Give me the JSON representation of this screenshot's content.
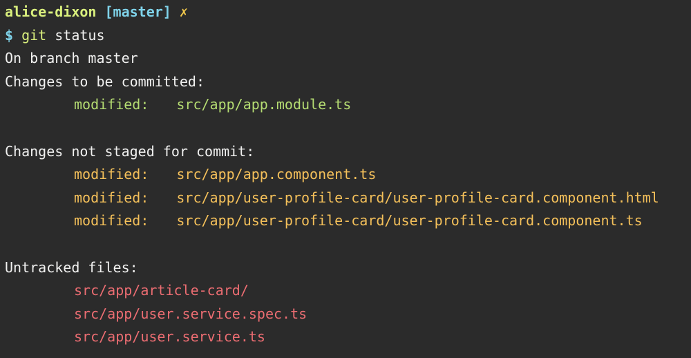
{
  "prompt": {
    "user": "alice-dixon",
    "branch": "[master]",
    "dirty_marker": "✗",
    "dollar": "$",
    "command_bin": "git",
    "command_arg": "status"
  },
  "output": {
    "on_branch": "On branch master",
    "staged_header": "Changes to be committed:",
    "staged": [
      {
        "status": "modified:",
        "path": "src/app/app.module.ts"
      }
    ],
    "unstaged_header": "Changes not staged for commit:",
    "unstaged": [
      {
        "status": "modified:",
        "path": "src/app/app.component.ts"
      },
      {
        "status": "modified:",
        "path": "src/app/user-profile-card/user-profile-card.component.html"
      },
      {
        "status": "modified:",
        "path": "src/app/user-profile-card/user-profile-card.component.ts"
      }
    ],
    "untracked_header": "Untracked files:",
    "untracked": [
      "src/app/article-card/",
      "src/app/user.service.spec.ts",
      "src/app/user.service.ts"
    ]
  },
  "colors": {
    "background": "#2b2b2b",
    "foreground": "#f1f1f0",
    "user": "#d9ef7d",
    "branch": "#7fd3ea",
    "staged": "#b5dc72",
    "unstaged": "#f4c05a",
    "untracked": "#ec6d72"
  }
}
